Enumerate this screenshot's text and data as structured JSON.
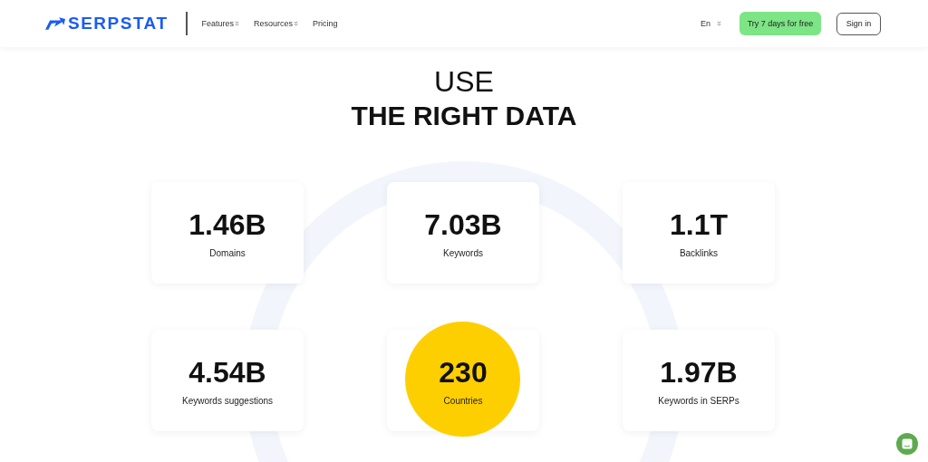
{
  "header": {
    "logo": "SERPSTAT",
    "nav": [
      {
        "label": "Features",
        "dropdown": true
      },
      {
        "label": "Resources",
        "dropdown": true
      },
      {
        "label": "Pricing",
        "dropdown": false
      }
    ],
    "language": "En",
    "trial_button": "Try 7 days for free",
    "signin_button": "Sign in"
  },
  "heading": {
    "line_1": "USE",
    "line_2": "THE RIGHT DATA"
  },
  "stats": [
    {
      "value": "1.46B",
      "label": "Domains",
      "highlighted": false
    },
    {
      "value": "7.03B",
      "label": "Keywords",
      "highlighted": false
    },
    {
      "value": "1.1T",
      "label": "Backlinks",
      "highlighted": false
    },
    {
      "value": "4.54B",
      "label": "Keywords suggestions",
      "highlighted": false
    },
    {
      "value": "230",
      "label": "Countries",
      "highlighted": true
    },
    {
      "value": "1.97B",
      "label": "Keywords in SERPs",
      "highlighted": false
    }
  ]
}
